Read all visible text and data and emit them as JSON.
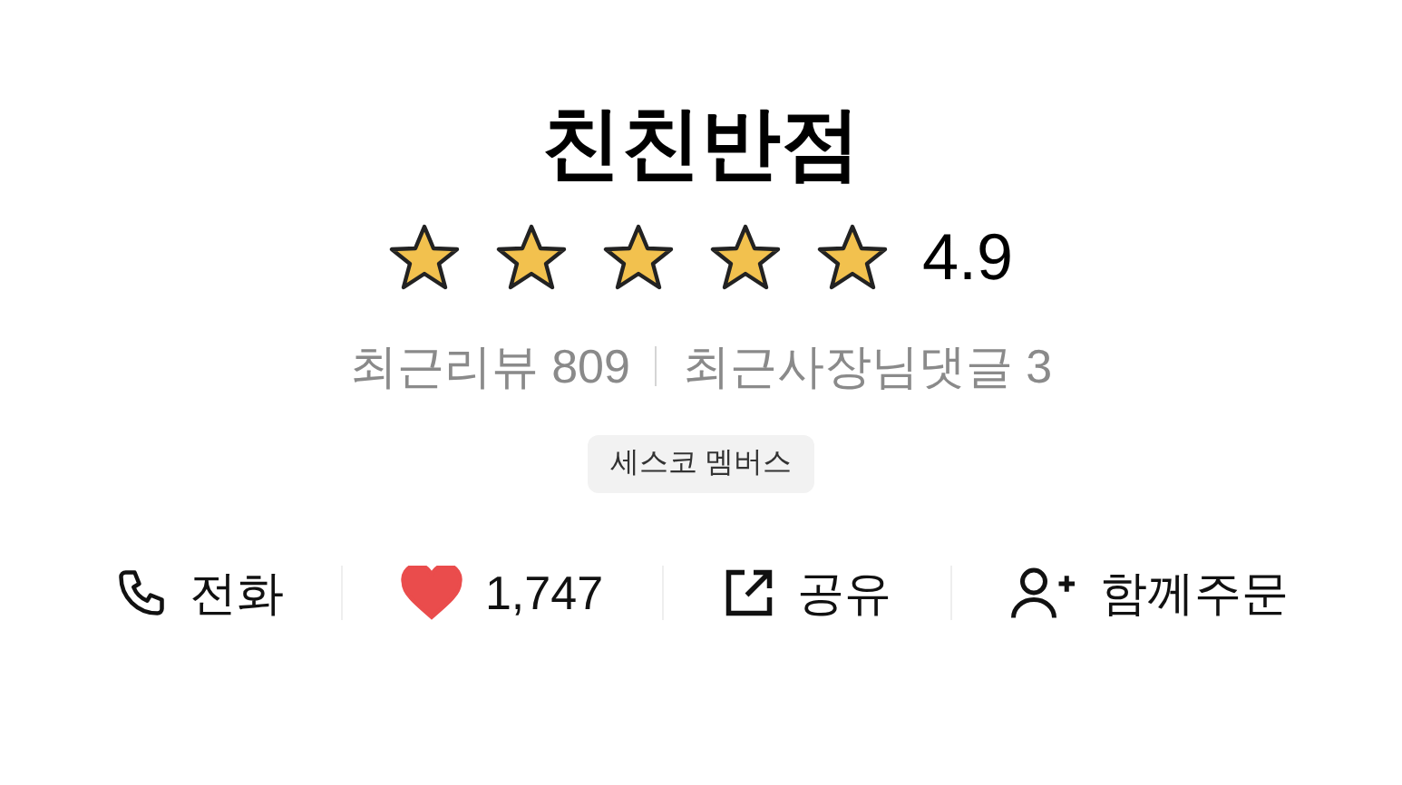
{
  "store": {
    "name": "친친반점",
    "stars": 5,
    "rating": "4.9"
  },
  "review_stats": [
    {
      "label": "최근리뷰 809"
    },
    {
      "label": "최근사장님댓글 3"
    }
  ],
  "badge": "세스코 멤버스",
  "actions": [
    {
      "kind": "phone",
      "label": "전화"
    },
    {
      "kind": "like",
      "label": "1,747",
      "liked": true
    },
    {
      "kind": "share",
      "label": "공유"
    },
    {
      "kind": "group",
      "label": "함께주문"
    }
  ]
}
